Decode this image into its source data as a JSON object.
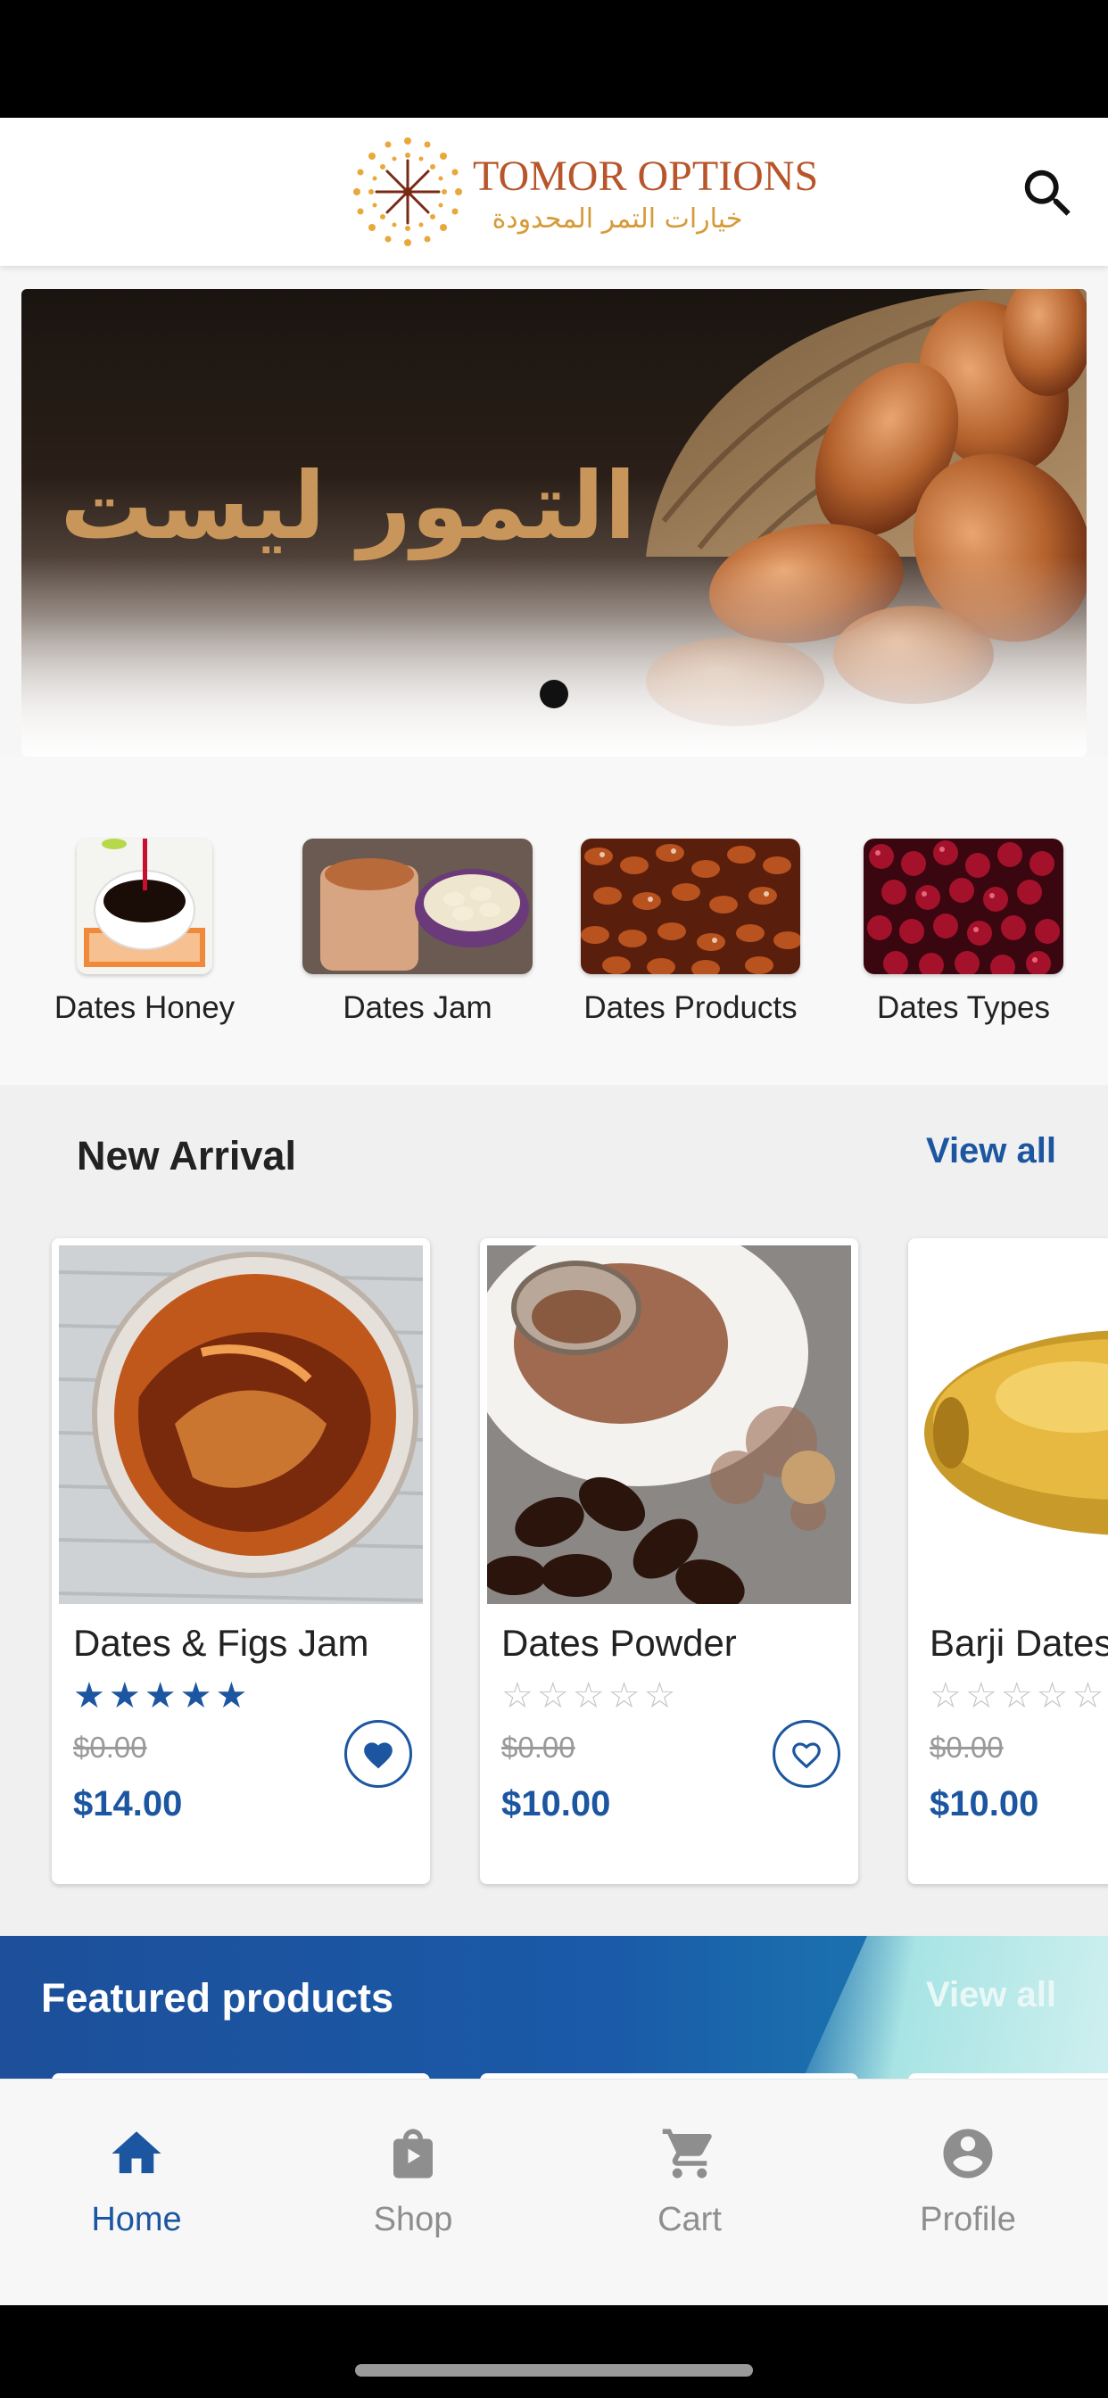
{
  "header": {
    "brand_name": "TOMOR OPTIONS",
    "brand_name_ar": "خيارات التمر المحدودة",
    "search_icon": "search-icon"
  },
  "hero": {
    "text": "التمور ليست مجرد",
    "slide_indicator_count": 1,
    "active_slide": 1
  },
  "categories": [
    {
      "label": "Dates Honey"
    },
    {
      "label": "Dates Jam"
    },
    {
      "label": "Dates Products"
    },
    {
      "label": "Dates Types"
    }
  ],
  "new_arrival": {
    "title": "New Arrival",
    "view_all": "View all",
    "products": [
      {
        "name": "Dates & Figs Jam",
        "rating": 5,
        "old_price": "$0.00",
        "price": "$14.00",
        "favorited": true
      },
      {
        "name": "Dates Powder",
        "rating": 0,
        "old_price": "$0.00",
        "price": "$10.00",
        "favorited": false
      },
      {
        "name": "Barji Dates",
        "rating": 0,
        "old_price": "$0.00",
        "price": "$10.00",
        "favorited": false
      }
    ]
  },
  "featured": {
    "title": "Featured products",
    "view_all": "View all"
  },
  "bottom_nav": {
    "items": [
      {
        "label": "Home",
        "icon": "home-icon",
        "active": true
      },
      {
        "label": "Shop",
        "icon": "shopping-bag-icon",
        "active": false
      },
      {
        "label": "Cart",
        "icon": "cart-icon",
        "active": false
      },
      {
        "label": "Profile",
        "icon": "account-circle-icon",
        "active": false
      }
    ]
  },
  "colors": {
    "accent": "#1c56a0",
    "brand_text": "#b8552a",
    "brand_gold": "#d79a38",
    "inactive": "#8e8e8e"
  }
}
